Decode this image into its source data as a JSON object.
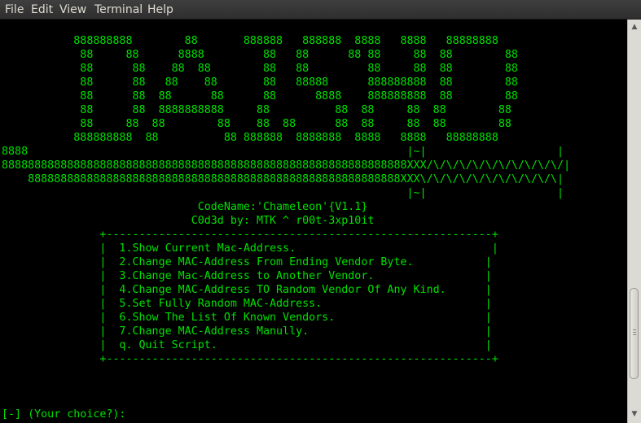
{
  "menubar": {
    "items": [
      "File",
      "Edit",
      "View",
      "Terminal",
      "Help"
    ]
  },
  "terminal": {
    "lines": [
      "           888888888        88       888888   888888  8888   8888   88888888",
      "            88     88      8888         88   88      88 88     88  88        88",
      "            88      88    88  88        88   88         88     88  88        88",
      "            88      88   88    88       88   88888      888888888  88        88",
      "            88      88  88      88      88      8888    888888888  88        88",
      "            88      88  8888888888     88          88  88     88  88        88",
      "            88     88  88        88    88  88      88  88     88  88        88",
      "           888888888  88          88 888888  8888888  8888   8888   88888888",
      "8888                                                          |~|                    |",
      "88888888888888888888888888888888888888888888888888888888888888XXX/\\/\\/\\/\\/\\/\\/\\/\\/\\/\\/|",
      "    888888888888888888888888888888888888888888888888888888888XXX\\/\\/\\/\\/\\/\\/\\/\\/\\/\\/\\|",
      "                                                              |~|                    |",
      "                              CodeName:'Chameleon'{V1.1}",
      "                             C0d3d by: MTK ^ r00t-3xp10it",
      "               +-----------------------------------------------------------+",
      "               |  1.Show Current Mac-Address.                              |",
      "               |  2.Change MAC-Address From Ending Vendor Byte.           |",
      "               |  3.Change Mac-Address to Another Vendor.                 |",
      "               |  4.Change MAC-Address TO Random Vendor Of Any Kind.      |",
      "               |  5.Set Fully Random MAC-Address.                         |",
      "               |  6.Show The List Of Known Vendors.                       |",
      "               |  7.Change MAC-Address Manully.                           |",
      "               |  q. Quit Script.                                         |",
      "               +-----------------------------------------------------------+",
      "",
      "",
      "",
      "[-] (Your choice?):"
    ]
  }
}
